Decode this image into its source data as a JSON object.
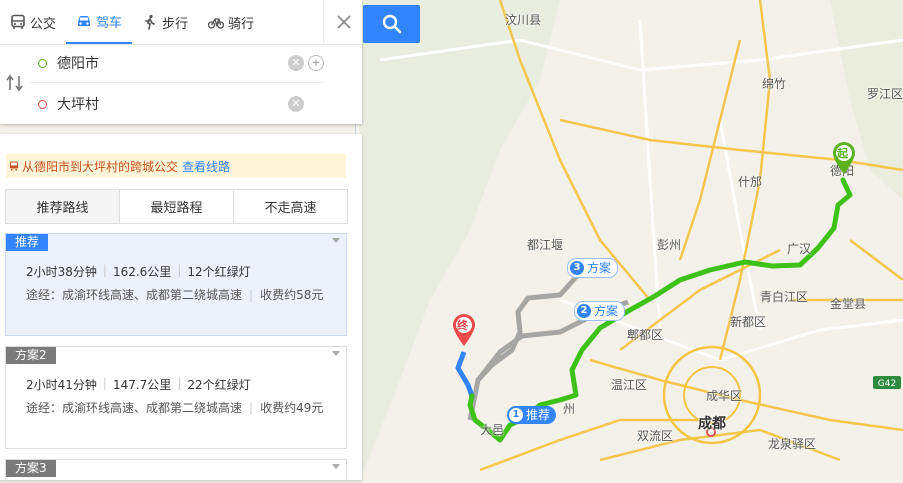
{
  "modes": [
    {
      "label": "公交",
      "icon": "bus-icon",
      "active": false
    },
    {
      "label": "驾车",
      "icon": "car-icon",
      "active": true
    },
    {
      "label": "步行",
      "icon": "walk-icon",
      "active": false
    },
    {
      "label": "骑行",
      "icon": "bike-icon",
      "active": false
    }
  ],
  "start": "德阳市",
  "end": "大坪村",
  "notice": {
    "text": "从德阳市到大坪村的跨城公交",
    "link": "查看线路"
  },
  "tabs": [
    "推荐路线",
    "最短路程",
    "不走高速"
  ],
  "plans": [
    {
      "badge": "推荐",
      "duration": "2小时38分钟",
      "distance": "162.6公里",
      "lights": "12个红绿灯",
      "via": "途经：成渝环线高速、成都第二绕城高速",
      "fee": "收费约58元"
    },
    {
      "badge": "方案2",
      "duration": "2小时41分钟",
      "distance": "147.7公里",
      "lights": "22个红绿灯",
      "via": "途经：成渝环线高速、成都第二绕城高速",
      "fee": "收费约49元"
    },
    {
      "badge": "方案3"
    }
  ],
  "map": {
    "labels": [
      "汶川县",
      "绵竹",
      "罗江区",
      "什邡",
      "德阳",
      "都江堰",
      "彭州",
      "广汉",
      "青白江区",
      "金堂县",
      "郫都区",
      "新都区",
      "温江区",
      "成华区",
      "成都",
      "双流区",
      "龙泉驿区",
      "大邑",
      "州"
    ],
    "route_tags": [
      {
        "num": "3",
        "label": "方案"
      },
      {
        "num": "2",
        "label": "方案"
      },
      {
        "num": "1",
        "label": "推荐"
      }
    ],
    "start_marker": "起",
    "end_marker": "终",
    "road_shield": "G42"
  },
  "colors": {
    "accent": "#3385ff",
    "route_green": "#3ec218",
    "start_green": "#5ab21d",
    "end_red": "#ed4a4a",
    "badge_blue": "#3385ff",
    "badge_gray": "#7a7a7a"
  }
}
